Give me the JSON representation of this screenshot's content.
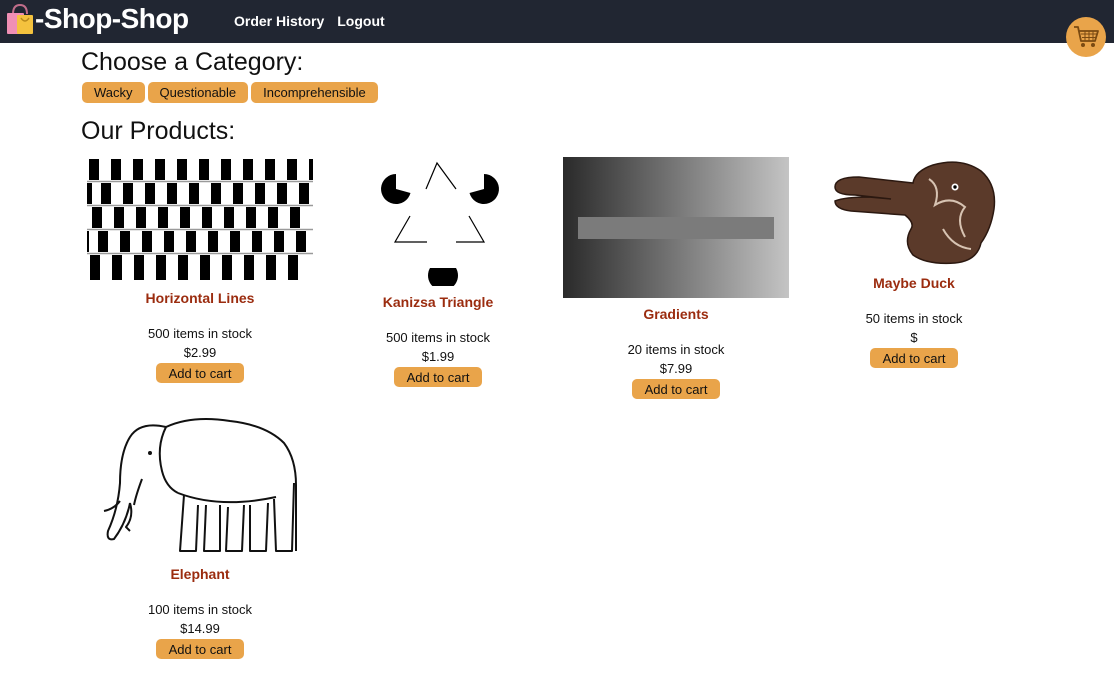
{
  "header": {
    "brand": "-Shop-Shop",
    "nav": [
      "Order History",
      "Logout"
    ],
    "accent_color": "#e9a44a",
    "bar_color": "#212632"
  },
  "categories": {
    "heading": "Choose a Category:",
    "items": [
      "Wacky",
      "Questionable",
      "Incomprehensible"
    ]
  },
  "products": {
    "heading": "Our Products:",
    "items": [
      {
        "name": "Horizontal Lines",
        "stock": "500 items in stock",
        "price": "$2.99",
        "button": "Add to cart",
        "icon": "cafe-wall-illusion-image"
      },
      {
        "name": "Kanizsa Triangle",
        "stock": "500 items in stock",
        "price": "$1.99",
        "button": "Add to cart",
        "icon": "kanizsa-triangle-image"
      },
      {
        "name": "Gradients",
        "stock": "20 items in stock",
        "price": "$7.99",
        "button": "Add to cart",
        "icon": "gradient-illusion-image"
      },
      {
        "name": "Maybe Duck",
        "stock": "50 items in stock",
        "price": "$",
        "button": "Add to cart",
        "icon": "duck-rabbit-image"
      },
      {
        "name": "Elephant",
        "stock": "100 items in stock",
        "price": "$14.99",
        "button": "Add to cart",
        "icon": "elephant-legs-illusion-image"
      }
    ]
  }
}
